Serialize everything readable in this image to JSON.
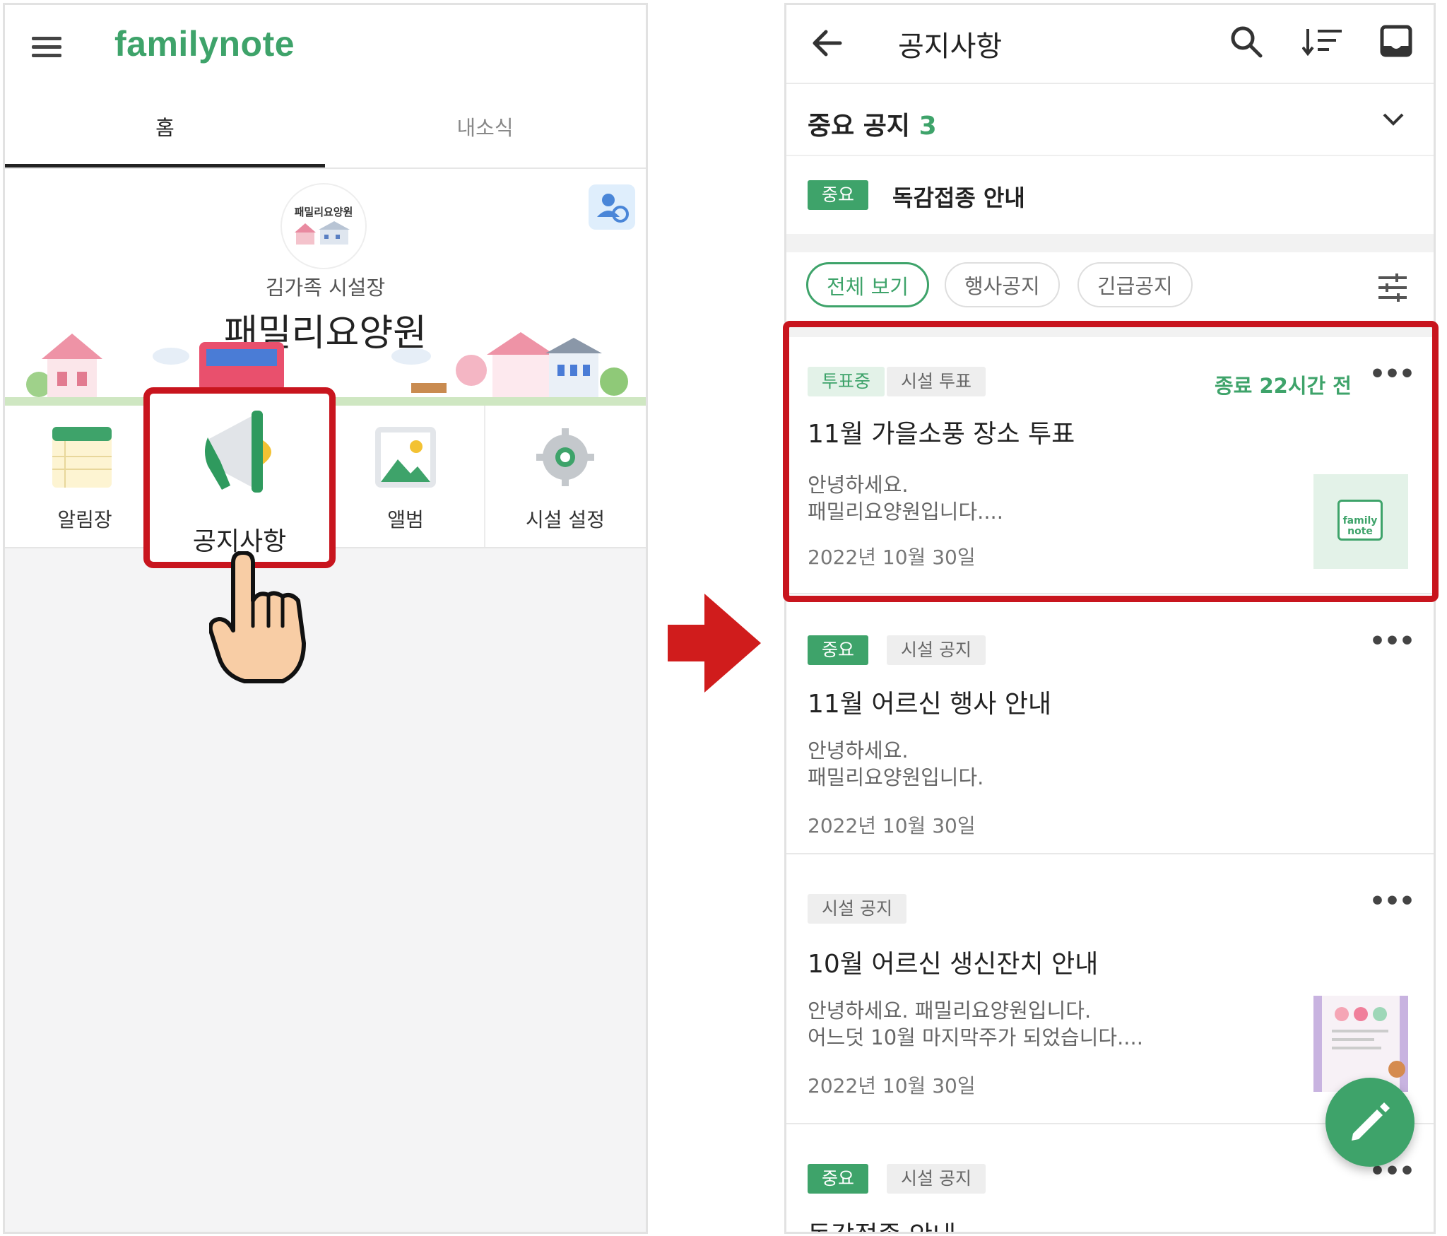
{
  "left_screen": {
    "app_logo": "familynote",
    "tabs": [
      {
        "label": "홈"
      },
      {
        "label": "내소식"
      }
    ],
    "profile": {
      "avatar_text": "패밀리요양원",
      "subtitle": "김가족 시설장",
      "facility_name": "패밀리요양원"
    },
    "menu": [
      {
        "label": "알림장",
        "icon": "calendar-icon"
      },
      {
        "label": "공지사항",
        "icon": "megaphone-icon"
      },
      {
        "label": "앨범",
        "icon": "image-icon"
      },
      {
        "label": "시설 설정",
        "icon": "gear-icon"
      }
    ]
  },
  "right_screen": {
    "header_title": "공지사항",
    "important_section": {
      "label": "중요 공지",
      "count": "3",
      "item_tag": "중요",
      "item_title": "독감접종 안내"
    },
    "filters": [
      "전체 보기",
      "행사공지",
      "긴급공지"
    ],
    "posts": [
      {
        "tags": [
          "투표중",
          "시설 투표"
        ],
        "status": "종료 22시간 전",
        "title": "11월 가을소풍 장소 투표",
        "body": "안녕하세요.\n패밀리요양원입니다....",
        "date": "2022년 10월 30일",
        "thumbnail_text": "family note"
      },
      {
        "tags": [
          "중요",
          "시설 공지"
        ],
        "title": "11월 어르신 행사 안내",
        "body": "안녕하세요.\n패밀리요양원입니다.",
        "date": "2022년 10월 30일"
      },
      {
        "tags": [
          "시설 공지"
        ],
        "title": "10월 어르신 생신잔치 안내",
        "body": "안녕하세요. 패밀리요양원입니다.\n어느덧 10월 마지막주가 되었습니다....",
        "date": "2022년 10월 30일"
      },
      {
        "tags": [
          "중요",
          "시설 공지"
        ],
        "title": "독감접종 안내"
      }
    ]
  },
  "colors": {
    "brand_green": "#3ea36a",
    "highlight_red": "#c8151e"
  }
}
